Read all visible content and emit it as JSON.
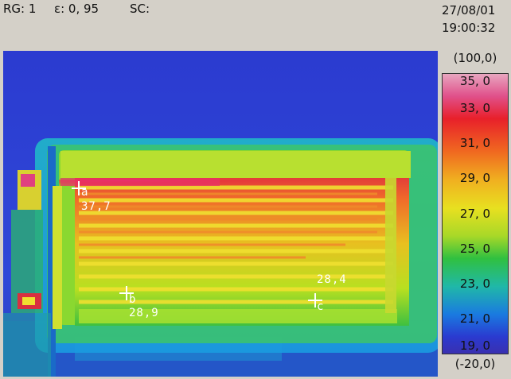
{
  "header": {
    "rg": "RG: 1",
    "emissivity": "ε: 0, 95",
    "sc": "SC:",
    "date": "27/08/01",
    "time": "19:00:32"
  },
  "scale": {
    "range_max": "(100,0)",
    "range_min": "(-20,0)",
    "ticks": [
      "35, 0",
      "33, 0",
      "31, 0",
      "29, 0",
      "27, 0",
      "25, 0",
      "23, 0",
      "21, 0",
      "19, 0"
    ]
  },
  "markers": {
    "a": {
      "letter": "a",
      "value": "37,7"
    },
    "b": {
      "letter": "b",
      "value": "28,9"
    },
    "c": {
      "letter": "c",
      "value": "28,4"
    }
  },
  "colors": {
    "background": "#d4d0c8",
    "cold": "#2a34c9",
    "warm": "#e8e020",
    "hot": "#e0205a"
  }
}
